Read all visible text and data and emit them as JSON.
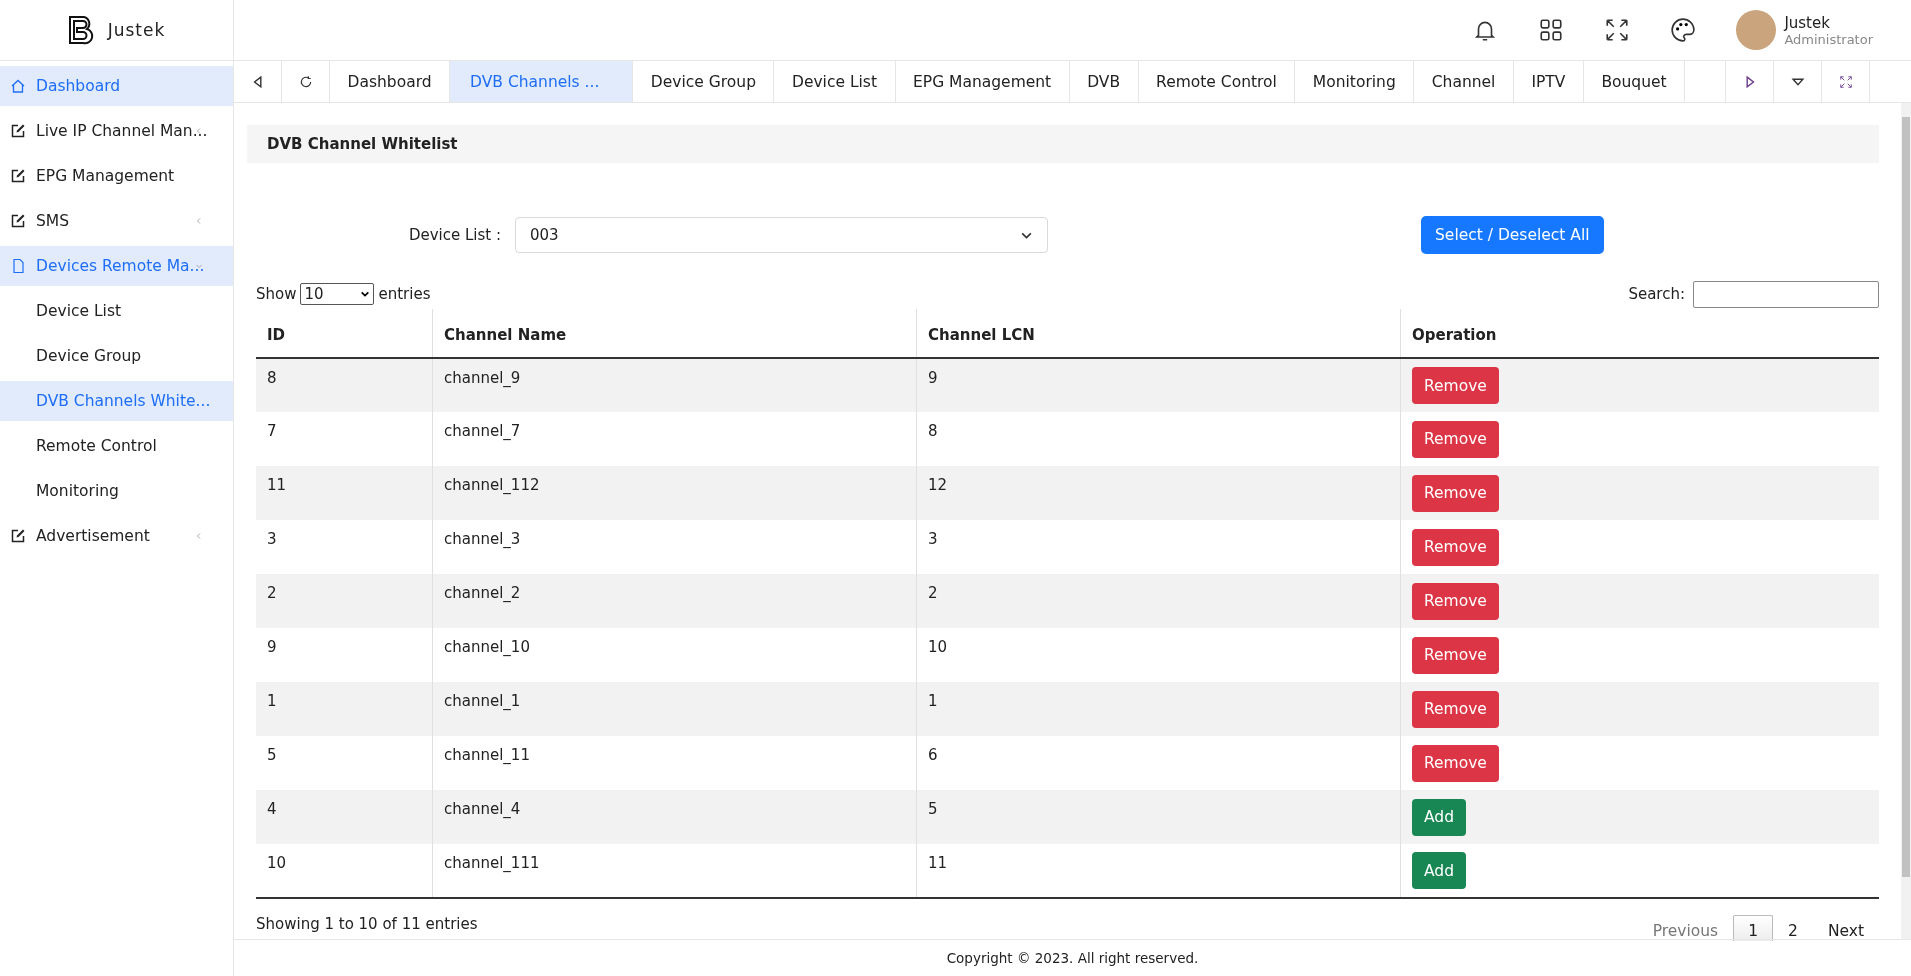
{
  "brand": {
    "name": "Justek"
  },
  "sidebar": {
    "items": [
      {
        "label": "Dashboard",
        "kind": "home",
        "selected": true
      },
      {
        "label": "Live IP Channel Man...",
        "kind": "edit",
        "selected": false,
        "expanded": false
      },
      {
        "label": "EPG Management",
        "kind": "edit",
        "selected": false
      },
      {
        "label": "SMS",
        "kind": "edit",
        "selected": false,
        "expanded": false
      },
      {
        "label": "Devices Remote Ma...",
        "kind": "file",
        "selected": true,
        "expanded": true,
        "children": [
          {
            "label": "Device List",
            "selected": false
          },
          {
            "label": "Device Group",
            "selected": false
          },
          {
            "label": "DVB Channels White...",
            "selected": true
          },
          {
            "label": "Remote Control",
            "selected": false
          },
          {
            "label": "Monitoring",
            "selected": false
          }
        ]
      },
      {
        "label": "Advertisement",
        "kind": "edit",
        "selected": false,
        "expanded": false
      }
    ]
  },
  "user": {
    "name": "Justek",
    "role": "Administrator"
  },
  "tabs": [
    {
      "label": "Dashboard",
      "selected": false
    },
    {
      "label": "DVB Channels ...",
      "selected": true
    },
    {
      "label": "Device Group",
      "selected": false
    },
    {
      "label": "Device List",
      "selected": false
    },
    {
      "label": "EPG Management",
      "selected": false
    },
    {
      "label": "DVB",
      "selected": false
    },
    {
      "label": "Remote Control",
      "selected": false
    },
    {
      "label": "Monitoring",
      "selected": false
    },
    {
      "label": "Channel",
      "selected": false
    },
    {
      "label": "IPTV",
      "selected": false
    },
    {
      "label": "Bouquet",
      "selected": false
    }
  ],
  "panel": {
    "title": "DVB Channel Whitelist",
    "device_label": "Device List :",
    "device_value": "003",
    "select_all_button": "Select / Deselect All",
    "show_label": "Show",
    "page_size": "10",
    "entries_label": "entries",
    "search_label": "Search:",
    "table": {
      "columns": [
        "ID",
        "Channel Name",
        "Channel LCN",
        "Operation"
      ],
      "rows": [
        {
          "id": "8",
          "name": "channel_9",
          "lcn": "9",
          "action": {
            "label": "Remove",
            "kind": "remove"
          }
        },
        {
          "id": "7",
          "name": "channel_7",
          "lcn": "8",
          "action": {
            "label": "Remove",
            "kind": "remove"
          }
        },
        {
          "id": "11",
          "name": "channel_112",
          "lcn": "12",
          "action": {
            "label": "Remove",
            "kind": "remove"
          }
        },
        {
          "id": "3",
          "name": "channel_3",
          "lcn": "3",
          "action": {
            "label": "Remove",
            "kind": "remove"
          }
        },
        {
          "id": "2",
          "name": "channel_2",
          "lcn": "2",
          "action": {
            "label": "Remove",
            "kind": "remove"
          }
        },
        {
          "id": "9",
          "name": "channel_10",
          "lcn": "10",
          "action": {
            "label": "Remove",
            "kind": "remove"
          }
        },
        {
          "id": "1",
          "name": "channel_1",
          "lcn": "1",
          "action": {
            "label": "Remove",
            "kind": "remove"
          }
        },
        {
          "id": "5",
          "name": "channel_11",
          "lcn": "6",
          "action": {
            "label": "Remove",
            "kind": "remove"
          }
        },
        {
          "id": "4",
          "name": "channel_4",
          "lcn": "5",
          "action": {
            "label": "Add",
            "kind": "add"
          }
        },
        {
          "id": "10",
          "name": "channel_111",
          "lcn": "11",
          "action": {
            "label": "Add",
            "kind": "add"
          }
        }
      ]
    },
    "info": "Showing 1 to 10 of 11 entries",
    "pagination": {
      "previous": {
        "label": "Previous",
        "disabled": true
      },
      "pages": [
        {
          "label": "1",
          "selected": true
        },
        {
          "label": "2",
          "selected": false
        }
      ],
      "next": {
        "label": "Next",
        "disabled": false
      }
    }
  },
  "footer": "Copyright © 2023. All right reserved."
}
